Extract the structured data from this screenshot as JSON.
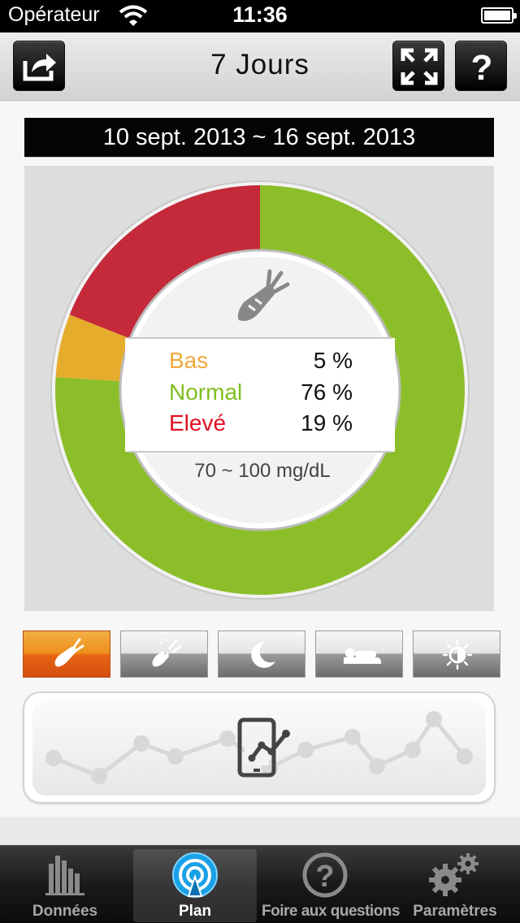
{
  "status": {
    "carrier": "Opérateur",
    "time": "11:36"
  },
  "header": {
    "title": "7 Jours",
    "share_icon": "share-icon",
    "expand_icon": "expand-icon",
    "help_icon": "help-icon"
  },
  "date_range": "10 sept. 2013 ~ 16 sept. 2013",
  "summary": {
    "center_icon": "carrot-icon",
    "items": [
      {
        "label": "Bas",
        "value": "5 %",
        "color": "#f0a83c"
      },
      {
        "label": "Normal",
        "value": "76 %",
        "color": "#7fbf1e"
      },
      {
        "label": "Elevé",
        "value": "19 %",
        "color": "#e01020"
      }
    ],
    "range": "70 ~ 100 mg/dL"
  },
  "chart_data": {
    "type": "pie",
    "categories": [
      "Bas",
      "Normal",
      "Elevé"
    ],
    "values": [
      5,
      76,
      19
    ],
    "colors": [
      "#e6ac2c",
      "#8cbe2a",
      "#c42a3a"
    ]
  },
  "meal_tabs": [
    {
      "id": "carrot",
      "icon": "carrot-icon",
      "active": true
    },
    {
      "id": "carrot-bite",
      "icon": "eaten-carrot-icon",
      "active": false
    },
    {
      "id": "night",
      "icon": "moon-icon",
      "active": false
    },
    {
      "id": "sleep",
      "icon": "bed-icon",
      "active": false
    },
    {
      "id": "wake",
      "icon": "sunrise-icon",
      "active": false
    }
  ],
  "graph_button": {
    "icon": "phone-chart-icon"
  },
  "tab_bar": [
    {
      "label": "Données",
      "icon": "bar-chart-icon",
      "selected": false
    },
    {
      "label": "Plan",
      "icon": "broadcast-icon",
      "selected": true
    },
    {
      "label": "Foire aux questions",
      "icon": "question-circle-icon",
      "selected": false
    },
    {
      "label": "Paramètres",
      "icon": "gears-icon",
      "selected": false
    }
  ],
  "colors": {
    "active_tab": "#e8761a",
    "header_bg": "#dcdcdc",
    "tab_bar_bg": "#111111"
  }
}
